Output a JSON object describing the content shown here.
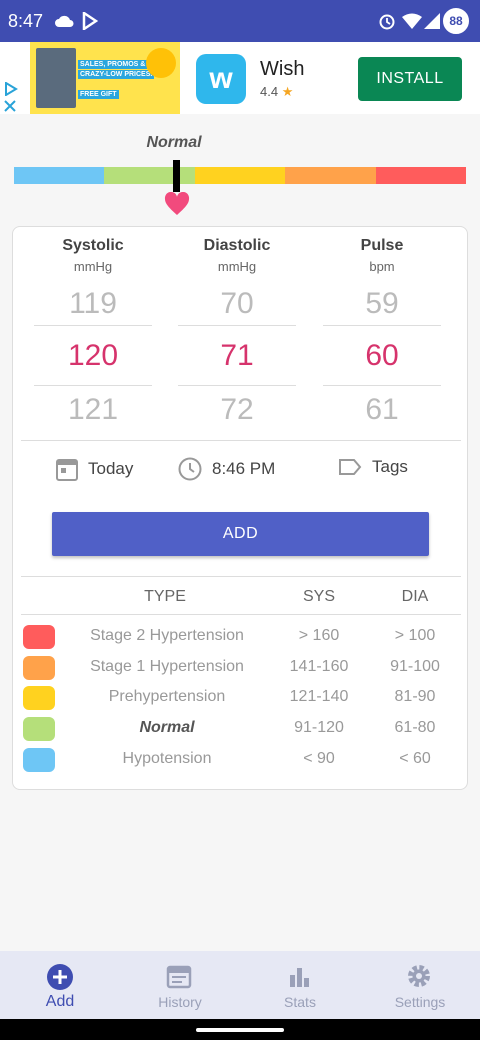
{
  "status_bar": {
    "time": "8:47",
    "battery": "88"
  },
  "ad": {
    "banner_text_1": "SALES, PROMOS &",
    "banner_text_2": "CRAZY-LOW PRICES.",
    "banner_text_3": "FREE GIFT",
    "app_name": "Wish",
    "rating": "4.4",
    "install_label": "INSTALL"
  },
  "gauge": {
    "label": "Normal",
    "level": 0.36,
    "colors": [
      "#6ec6f5",
      "#b5df7a",
      "#ffd21f",
      "#ffa24a",
      "#ff5c5c"
    ]
  },
  "pickers": [
    {
      "header": "Systolic",
      "unit": "mmHg",
      "prev": "119",
      "value": "120",
      "next": "121"
    },
    {
      "header": "Diastolic",
      "unit": "mmHg",
      "prev": "70",
      "value": "71",
      "next": "72"
    },
    {
      "header": "Pulse",
      "unit": "bpm",
      "prev": "59",
      "value": "60",
      "next": "61"
    }
  ],
  "meta": {
    "date": "Today",
    "time": "8:46 PM",
    "tags": "Tags"
  },
  "add_button": "ADD",
  "table": {
    "headers": {
      "type": "TYPE",
      "sys": "SYS",
      "dia": "DIA"
    },
    "rows": [
      {
        "color": "#ff5c5c",
        "type": "Stage 2 Hypertension",
        "sys": "> 160",
        "dia": "> 100"
      },
      {
        "color": "#ffa24a",
        "type": "Stage 1 Hypertension",
        "sys": "141-160",
        "dia": "91-100"
      },
      {
        "color": "#ffd21f",
        "type": "Prehypertension",
        "sys": "121-140",
        "dia": "81-90"
      },
      {
        "color": "#b5df7a",
        "type": "Normal",
        "sys": "91-120",
        "dia": "61-80"
      },
      {
        "color": "#6ec6f5",
        "type": "Hypotension",
        "sys": "< 90",
        "dia": "< 60"
      }
    ]
  },
  "nav": [
    {
      "label": "Add",
      "icon": "add-circle-icon"
    },
    {
      "label": "History",
      "icon": "calendar-icon"
    },
    {
      "label": "Stats",
      "icon": "bar-chart-icon"
    },
    {
      "label": "Settings",
      "icon": "gear-icon"
    }
  ],
  "accent": "#3f4db1"
}
